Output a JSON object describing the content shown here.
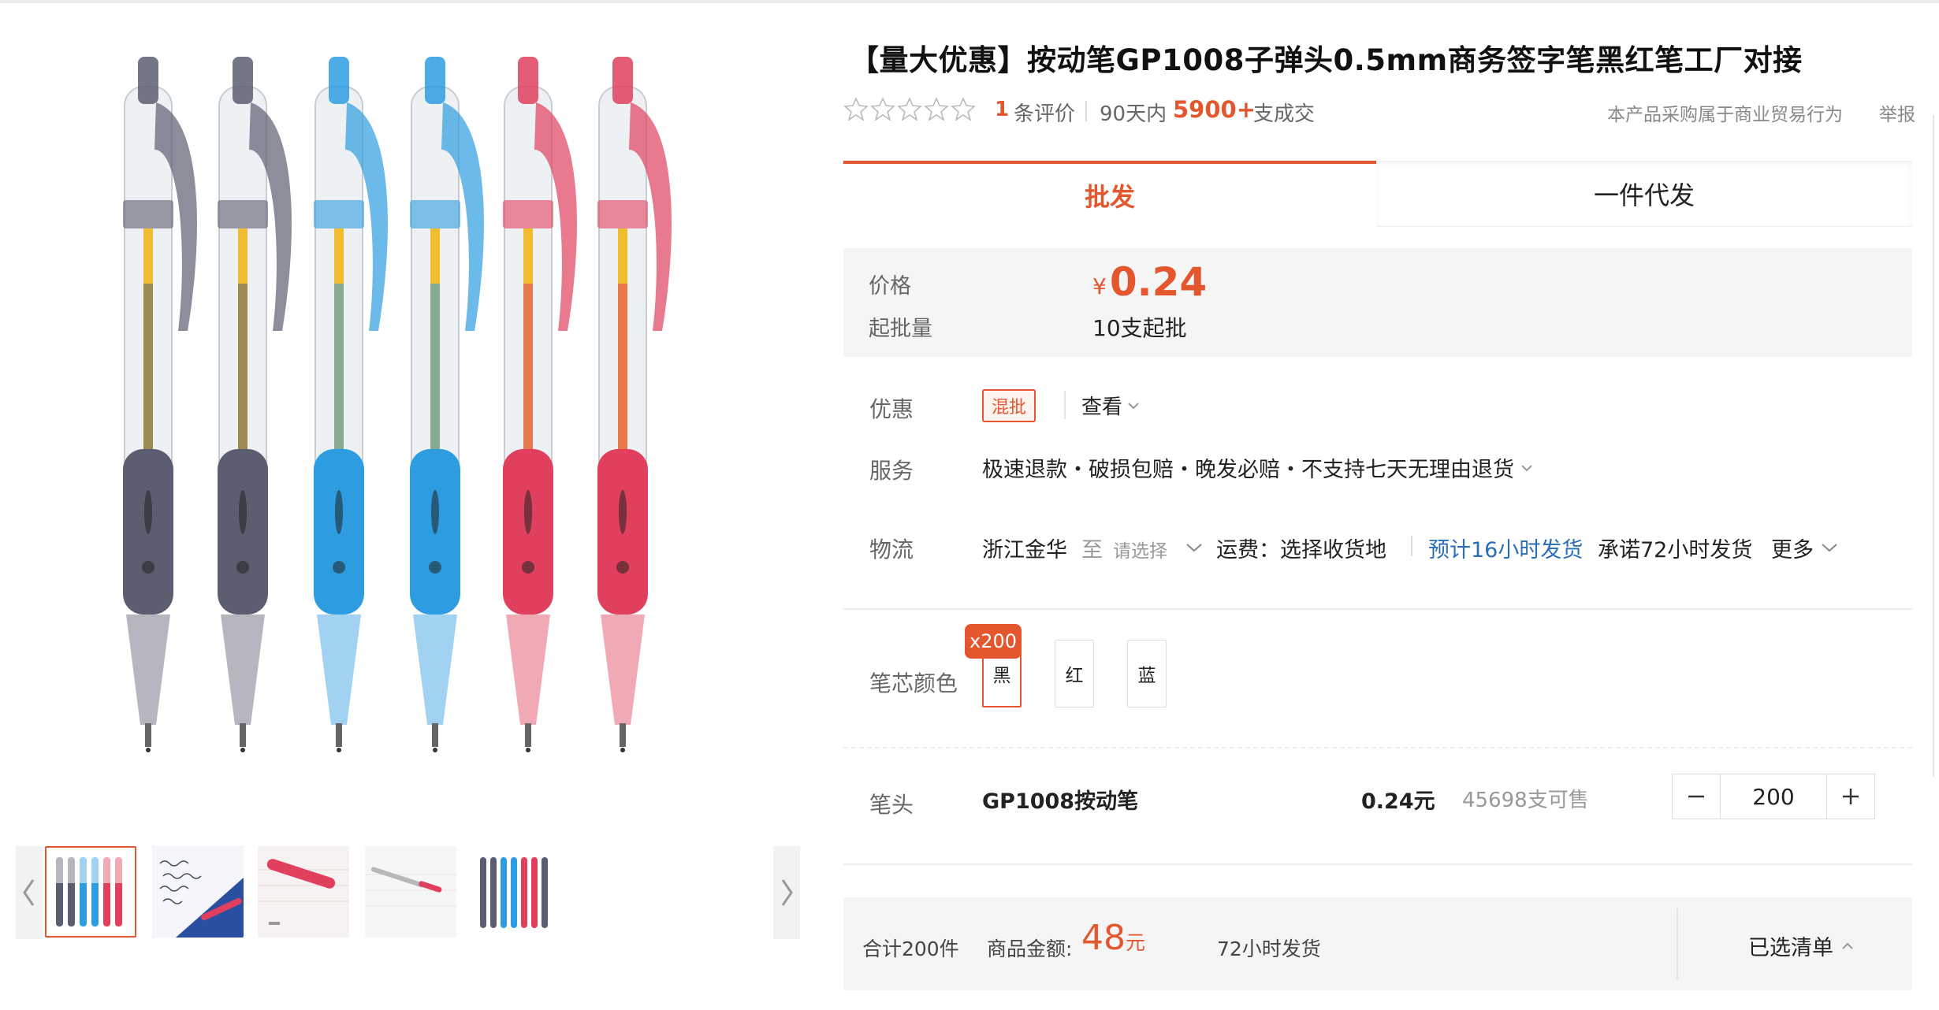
{
  "product": {
    "title": "【量大优惠】按动笔GP1008子弹头0.5mm商务签字笔黑红笔工厂对接",
    "review_count": "1",
    "review_label": "条评价",
    "days_label": "90天内",
    "sold_count": "5900+",
    "sold_label": "支成交",
    "business_note": "本产品采购属于商业贸易行为",
    "report_label": "举报"
  },
  "gallery": {
    "pen_colors": [
      "#5b5e70",
      "#5b5e70",
      "#2e9ce0",
      "#2e9ce0",
      "#e0405e",
      "#e0405e"
    ],
    "thumbnail_count": 5,
    "active_thumbnail": 1
  },
  "tabs": [
    {
      "label": "批发"
    },
    {
      "label": "一件代发"
    }
  ],
  "price_box": {
    "price_label": "价格",
    "currency": "¥",
    "price": "0.24",
    "moq_label": "起批量",
    "moq": "10支起批"
  },
  "promo": {
    "label": "优惠",
    "badge": "混批",
    "view_label": "查看"
  },
  "service": {
    "label": "服务",
    "text": "极速退款・破损包赔・晚发必赔・不支持七天无理由退货"
  },
  "logistics": {
    "label": "物流",
    "origin": "浙江金华",
    "to_label": "至",
    "select_placeholder": "请选择",
    "freight": "运费：选择收货地",
    "estimate": "预计16小时发货",
    "promise": "承诺72小时发货",
    "more": "更多"
  },
  "refill_color": {
    "label": "笔芯颜色",
    "options": [
      "黑",
      "红",
      "蓝"
    ],
    "selected_badge": "x200"
  },
  "sku": {
    "label": "笔头",
    "name": "GP1008按动笔",
    "price": "0.24元",
    "stock": "45698支可售",
    "quantity": "200"
  },
  "summary": {
    "total_items": "合计200件",
    "amount_label": "商品金额:",
    "amount": "48",
    "amount_unit": "元",
    "ship_time": "72小时发货",
    "selected_list": "已选清单"
  },
  "colors": {
    "accent": "#e4572e",
    "link_blue": "#2a6ebb"
  }
}
